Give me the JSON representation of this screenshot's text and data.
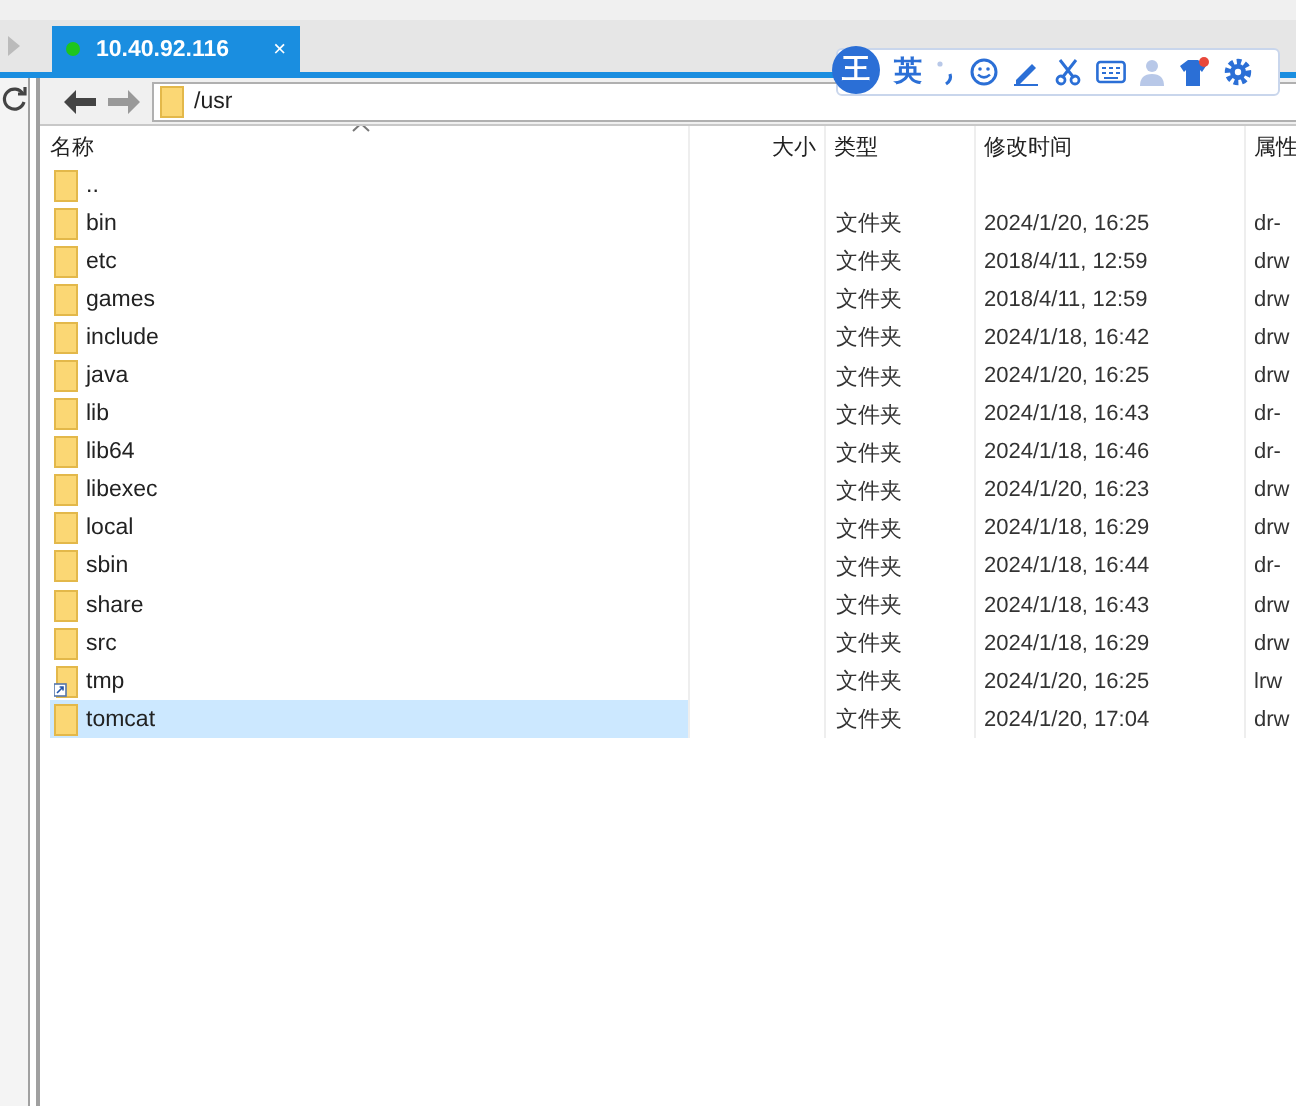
{
  "tabs": [
    {
      "label": "10.40.92.116",
      "selected": true,
      "connected": true,
      "close": "×"
    }
  ],
  "ime_toolbar": {
    "logo": "王",
    "mode": "英"
  },
  "address": {
    "value": "/usr"
  },
  "table": {
    "columns": [
      "名称",
      "大小",
      "类型",
      "修改时间",
      "属性"
    ],
    "rows": [
      {
        "name": "..",
        "kind": "folder",
        "selected": false
      },
      {
        "name": "bin",
        "kind": "folder",
        "type": "文件夹",
        "modified": "2024/1/20, 16:25",
        "attr": "dr-",
        "selected": false
      },
      {
        "name": "etc",
        "kind": "folder",
        "type": "文件夹",
        "modified": "2018/4/11, 12:59",
        "attr": "drw",
        "selected": false
      },
      {
        "name": "games",
        "kind": "folder",
        "type": "文件夹",
        "modified": "2018/4/11, 12:59",
        "attr": "drw",
        "selected": false
      },
      {
        "name": "include",
        "kind": "folder",
        "type": "文件夹",
        "modified": "2024/1/18, 16:42",
        "attr": "drw",
        "selected": false
      },
      {
        "name": "java",
        "kind": "folder",
        "type": "文件夹",
        "modified": "2024/1/20, 16:25",
        "attr": "drw",
        "selected": false
      },
      {
        "name": "lib",
        "kind": "folder",
        "type": "文件夹",
        "modified": "2024/1/18, 16:43",
        "attr": "dr-",
        "selected": false
      },
      {
        "name": "lib64",
        "kind": "folder",
        "type": "文件夹",
        "modified": "2024/1/18, 16:46",
        "attr": "dr-",
        "selected": false
      },
      {
        "name": "libexec",
        "kind": "folder",
        "type": "文件夹",
        "modified": "2024/1/20, 16:23",
        "attr": "drw",
        "selected": false
      },
      {
        "name": "local",
        "kind": "folder",
        "type": "文件夹",
        "modified": "2024/1/18, 16:29",
        "attr": "drw",
        "selected": false
      },
      {
        "name": "sbin",
        "kind": "folder",
        "type": "文件夹",
        "modified": "2024/1/18, 16:44",
        "attr": "dr-",
        "selected": false
      },
      {
        "name": "share",
        "kind": "folder",
        "type": "文件夹",
        "modified": "2024/1/18, 16:43",
        "attr": "drw",
        "selected": false
      },
      {
        "name": "src",
        "kind": "folder",
        "type": "文件夹",
        "modified": "2024/1/18, 16:29",
        "attr": "drw",
        "selected": false
      },
      {
        "name": "tmp",
        "kind": "link",
        "type": "文件夹",
        "modified": "2024/1/20, 16:25",
        "attr": "lrw",
        "selected": false
      },
      {
        "name": "tomcat",
        "kind": "folder",
        "type": "文件夹",
        "modified": "2024/1/20, 17:04",
        "attr": "drw",
        "selected": true
      }
    ]
  }
}
